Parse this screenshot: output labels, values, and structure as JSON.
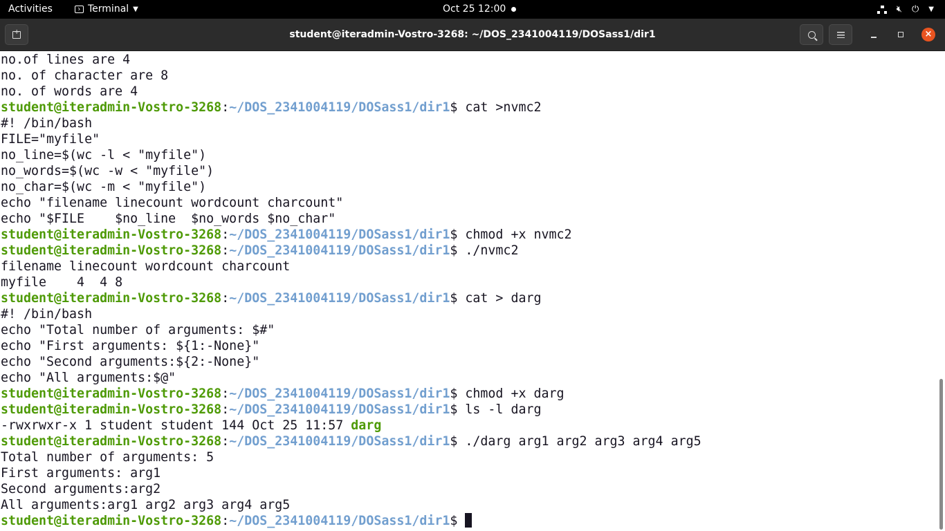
{
  "topbar": {
    "activities": "Activities",
    "app_menu": "Terminal",
    "clock": "Oct 25  12:00"
  },
  "window": {
    "title": "student@iteradmin-Vostro-3268: ~/DOS_2341004119/DOSass1/dir1"
  },
  "colors": {
    "prompt_user": "#4e9a06",
    "prompt_path": "#729fcf",
    "text": "#171421",
    "close_button": "#e95420"
  },
  "terminal": {
    "prompt_user": "student@iteradmin-Vostro-3268",
    "prompt_path": "~/DOS_2341004119/DOSass1/dir1",
    "lines": [
      {
        "text": "no.of lines are 4"
      },
      {
        "text": "no. of character are 8"
      },
      {
        "text": "no. of words are 4"
      },
      {
        "prompt": true,
        "cmd": "cat >nvmc2"
      },
      {
        "text": "#! /bin/bash"
      },
      {
        "text": "FILE=\"myfile\""
      },
      {
        "text": "no_line=$(wc -l < \"myfile\")"
      },
      {
        "text": "no_words=$(wc -w < \"myfile\")"
      },
      {
        "text": "no_char=$(wc -m < \"myfile\")"
      },
      {
        "text": "echo \"filename linecount wordcount charcount\""
      },
      {
        "text": "echo \"$FILE    $no_line  $no_words $no_char\""
      },
      {
        "prompt": true,
        "cmd": "chmod +x nvmc2"
      },
      {
        "prompt": true,
        "cmd": "./nvmc2"
      },
      {
        "text": "filename linecount wordcount charcount"
      },
      {
        "text": "myfile    4  4 8"
      },
      {
        "prompt": true,
        "cmd": "cat > darg"
      },
      {
        "text": "#! /bin/bash"
      },
      {
        "text": "echo \"Total number of arguments: $#\""
      },
      {
        "text": "echo \"First arguments: ${1:-None}\""
      },
      {
        "text": "echo \"Second arguments:${2:-None}\""
      },
      {
        "text": "echo \"All arguments:$@\""
      },
      {
        "prompt": true,
        "cmd": "chmod +x darg"
      },
      {
        "prompt": true,
        "cmd": "ls -l darg"
      },
      {
        "text": "-rwxrwxr-x 1 student student 144 Oct 25 11:57 ",
        "exe": "darg"
      },
      {
        "prompt": true,
        "cmd": "./darg arg1 arg2 arg3 arg4 arg5"
      },
      {
        "text": "Total number of arguments: 5"
      },
      {
        "text": "First arguments: arg1"
      },
      {
        "text": "Second arguments:arg2"
      },
      {
        "text": "All arguments:arg1 arg2 arg3 arg4 arg5"
      },
      {
        "prompt": true,
        "cmd": "",
        "cursor": true
      }
    ]
  }
}
